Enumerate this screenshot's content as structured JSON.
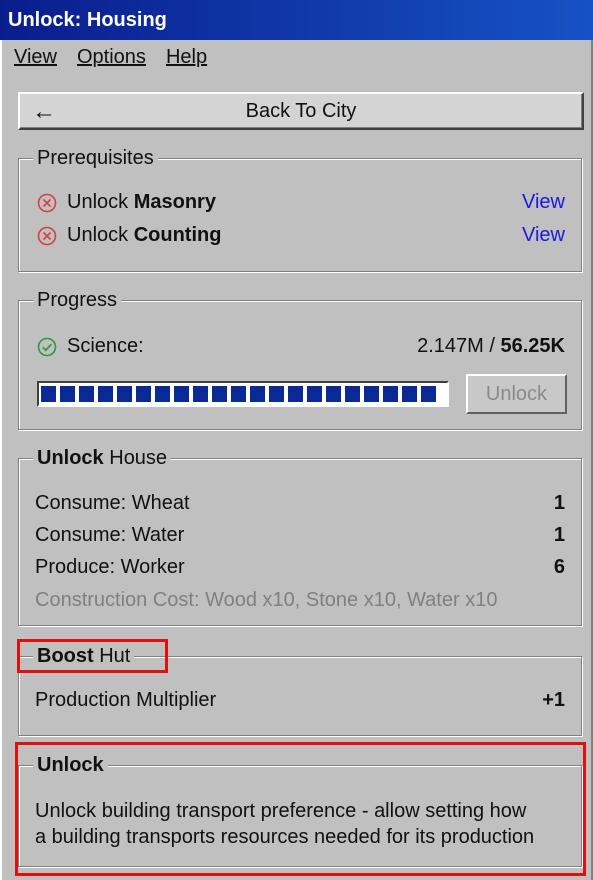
{
  "window": {
    "title": "Unlock: Housing"
  },
  "menu": {
    "items": [
      "View",
      "Options",
      "Help"
    ]
  },
  "back_button": {
    "label": "Back To City"
  },
  "prerequisites": {
    "title": "Prerequisites",
    "items": [
      {
        "prefix": "Unlock",
        "name": "Masonry",
        "link": "View",
        "status": "not-met"
      },
      {
        "prefix": "Unlock",
        "name": "Counting",
        "link": "View",
        "status": "not-met"
      }
    ]
  },
  "progress": {
    "title": "Progress",
    "label": "Science:",
    "current": "2.147M /",
    "required": "56.25K",
    "fill_percent": 100,
    "unlock_label": "Unlock",
    "unlock_enabled": false
  },
  "unlock_house": {
    "title_bold": "Unlock",
    "title_rest": " House",
    "rows": [
      {
        "label": "Consume: Wheat",
        "value": "1"
      },
      {
        "label": "Consume: Water",
        "value": "1"
      },
      {
        "label": "Produce: Worker",
        "value": "6"
      }
    ],
    "construction_cost": "Construction Cost: Wood x10, Stone x10, Water x10"
  },
  "boost": {
    "title_bold": "Boost",
    "title_rest": " Hut",
    "rows": [
      {
        "label": "Production Multiplier",
        "value": "+1"
      }
    ]
  },
  "unlock_desc": {
    "title": "Unlock",
    "line1": "Unlock building transport preference - allow setting how",
    "line2": "a building transports resources needed for its production"
  },
  "colors": {
    "title_bar": "#0a1d8c",
    "link": "#1a1adc",
    "progress_fill": "#0a2a96",
    "highlight": "#e01010",
    "error_icon": "#d64040",
    "ok_icon": "#2e9a3e"
  }
}
